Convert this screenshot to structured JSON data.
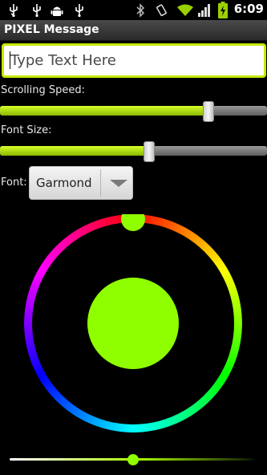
{
  "status_bar": {
    "time": "6:09",
    "icons": [
      "usb-icon",
      "usb-icon",
      "android-debug-icon",
      "usb-icon",
      "bluetooth-icon",
      "vibrate-icon",
      "wifi-icon",
      "signal-icon",
      "battery-charging-icon"
    ]
  },
  "title_bar": {
    "title": "PIXEL Message"
  },
  "message_input": {
    "placeholder": "Type Text Here",
    "value": ""
  },
  "scrolling_speed": {
    "label": "Scrolling Speed:",
    "value_fraction": 0.78
  },
  "font_size": {
    "label": "Font Size:",
    "value_fraction": 0.56
  },
  "font": {
    "label": "Font:",
    "selected": "Garmond"
  },
  "color_picker": {
    "selected_color": "#8fff00",
    "hue_thumb_color": "#8fff00",
    "value_fraction": 0.5
  },
  "colors": {
    "accent": "#c6e800",
    "seek_fill": "#a6d800"
  }
}
